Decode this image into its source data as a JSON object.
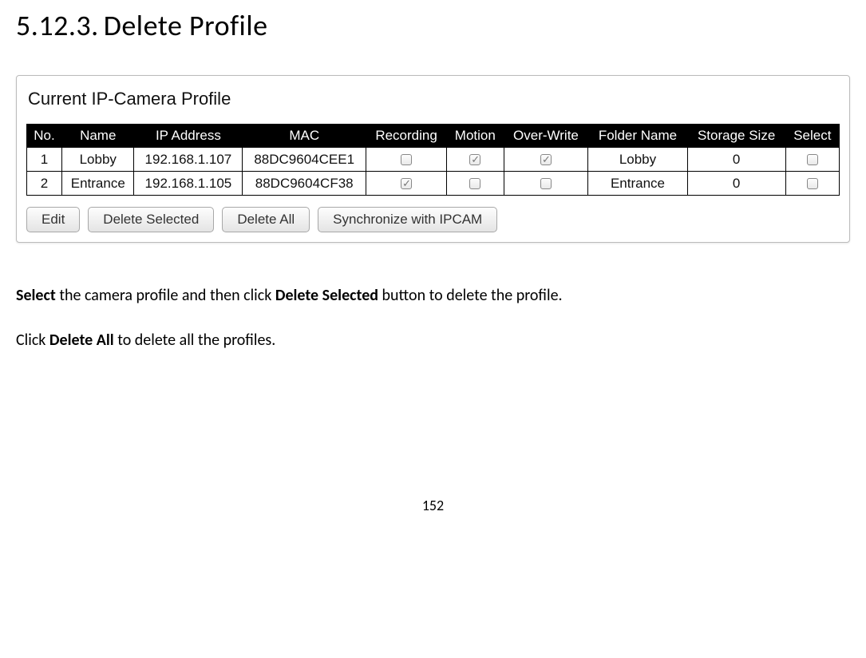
{
  "heading": {
    "number": "5.12.3.",
    "title": "Delete Profile"
  },
  "panel": {
    "title": "Current IP-Camera Profile",
    "columns": {
      "no": "No.",
      "name": "Name",
      "ip": "IP Address",
      "mac": "MAC",
      "recording": "Recording",
      "motion": "Motion",
      "overwrite": "Over-Write",
      "folder": "Folder Name",
      "storage": "Storage Size",
      "select": "Select"
    },
    "rows": [
      {
        "no": "1",
        "name": "Lobby",
        "ip": "192.168.1.107",
        "mac": "88DC9604CEE1",
        "recording": false,
        "motion": true,
        "overwrite": true,
        "folder": "Lobby",
        "storage": "0",
        "select": false
      },
      {
        "no": "2",
        "name": "Entrance",
        "ip": "192.168.1.105",
        "mac": "88DC9604CF38",
        "recording": true,
        "motion": false,
        "overwrite": false,
        "folder": "Entrance",
        "storage": "0",
        "select": false
      }
    ],
    "buttons": {
      "edit": "Edit",
      "delete_selected": "Delete Selected",
      "delete_all": "Delete All",
      "sync": "Synchronize with IPCAM"
    }
  },
  "instructions": {
    "p1_b1": "Select",
    "p1_t1": " the camera profile and then click ",
    "p1_b2": "Delete Selected",
    "p1_t2": " button to delete the profile.",
    "p2_t1": "Click ",
    "p2_b1": "Delete All",
    "p2_t2": " to delete all the profiles."
  },
  "page_number": "152"
}
